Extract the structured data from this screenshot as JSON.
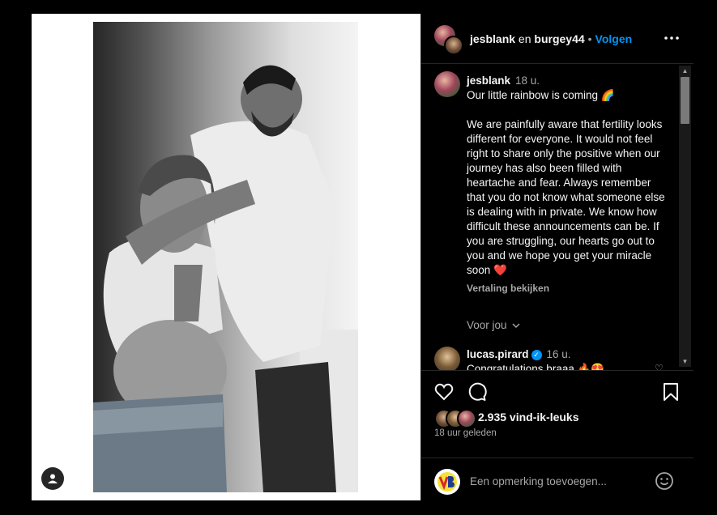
{
  "post": {
    "author": "jesblank",
    "conjunction": "en",
    "coauthor": "burgey44",
    "follow_label": "Volgen",
    "caption_time": "18 u.",
    "caption_line1": "Our little rainbow is coming 🌈",
    "caption_body": "We are painfully aware that fertility looks different for everyone. It would not feel right to share only the positive when our journey has also been filled with heartache and fear. Always remember that you do not know what someone else is dealing with in private. We know how difficult these announcements can be. If you are struggling, our hearts go out to you and we hope you get your miracle soon ❤️",
    "translate_label": "Vertaling bekijken",
    "see_you_label": "Voor jou",
    "likes": "2.935 vind-ik-leuks",
    "posted_ago": "18 uur geleden"
  },
  "comments": [
    {
      "user": "lucas.pirard",
      "time": "16 u.",
      "text": "Congratulations braaa 🔥😍"
    }
  ],
  "add_comment": {
    "placeholder": "Een opmerking toevoegen..."
  },
  "icons": {
    "more": "more-options-icon",
    "like": "heart-icon",
    "comment": "comment-icon",
    "save": "bookmark-icon",
    "emoji": "emoji-icon",
    "tag": "user-tag-icon"
  },
  "colors": {
    "accent": "#0095f6",
    "background": "#000000",
    "muted": "#a8a8a8"
  }
}
